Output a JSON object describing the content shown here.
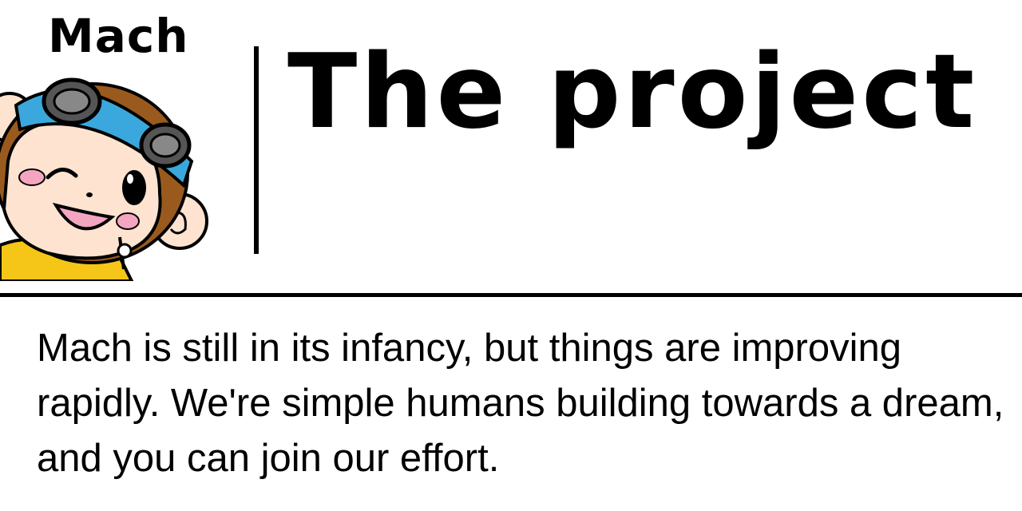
{
  "header": {
    "brand": "Mach",
    "title": "The project",
    "mascot_icon": "monkey-mascot-icon"
  },
  "main": {
    "intro": "Mach is still in its infancy, but things are improving rapidly. We're simple humans building towards a dream, and you can join our effort."
  },
  "colors": {
    "background": "#ffffff",
    "text": "#000000",
    "mascot_headband": "#3aa8dc",
    "mascot_fur": "#9a5a1e",
    "mascot_face": "#fde3d0",
    "mascot_cheek": "#f4a6c0",
    "mascot_jacket": "#f5c518"
  }
}
